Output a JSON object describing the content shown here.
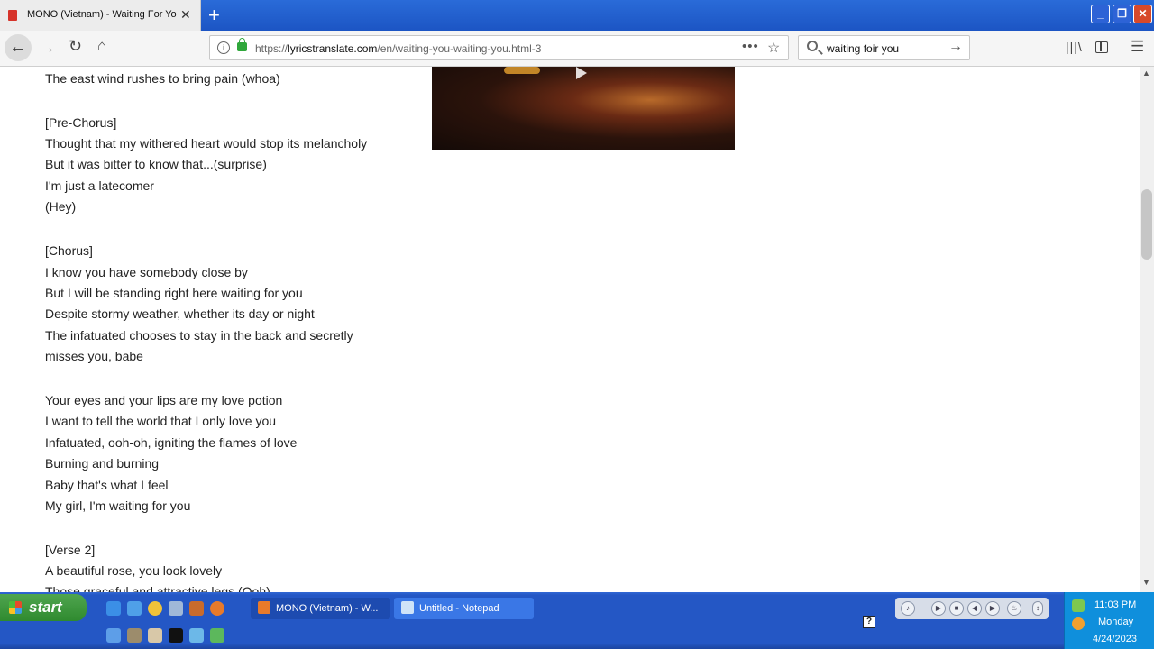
{
  "browser": {
    "tab_title": "MONO (Vietnam) - Waiting For You",
    "tab_close": "✕",
    "new_tab": "+",
    "url_prefix": "https://",
    "url_domain": "lyricstranslate.com",
    "url_path": "/en/waiting-you-waiting-you.html-3",
    "url_more": "•••",
    "search_query": "waiting foir you",
    "window_min": "_",
    "window_max": "❐",
    "window_close": "✕"
  },
  "lyrics": [
    "The east wind rushes to bring pain (whoa)",
    "[Pre-Chorus]",
    "Thought that my withered heart would stop its melancholy",
    "But it was bitter to know that...(surprise)",
    "I'm just a latecomer",
    "(Hey)",
    "[Chorus]",
    "I know you have somebody close by",
    "But I will be standing right here waiting for you",
    "Despite stormy weather, whether its day or night",
    "The infatuated chooses to stay in the back and secretly",
    "misses you, babe",
    "Your eyes and your lips are my love potion",
    "I want to tell the world that I only love you",
    "Infatuated, ooh-oh, igniting the flames of love",
    "Burning and burning",
    "Baby that's what I feel",
    "My girl, I'm waiting for you",
    "[Verse 2]",
    "A beautiful rose, you look lovely",
    "Those graceful and attractive legs (Ooh)"
  ],
  "taskbar": {
    "start_label": "start",
    "tasks": [
      {
        "label": "MONO (Vietnam) - W..."
      },
      {
        "label": "Untitled - Notepad"
      }
    ],
    "help": "?",
    "clock": {
      "time": "11:03 PM",
      "day": "Monday",
      "date": "4/24/2023"
    }
  }
}
